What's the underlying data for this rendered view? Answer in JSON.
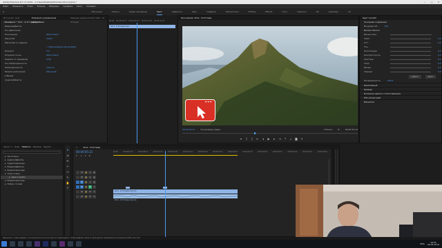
{
  "window": {
    "title": "Adobe Premiere Pro CC 2019 - C:\\Users\\Desktop\\Premiere Pro\\1.prproj *",
    "controls": [
      "—",
      "□",
      "✕"
    ]
  },
  "menu": [
    "Файл",
    "Изменить",
    "Клип",
    "Эпизод",
    "Маркеры",
    "Графика",
    "Окно",
    "Справка"
  ],
  "workspaces": {
    "items": [
      "Обучение",
      "Сборка",
      "Редактирование",
      "Цвет",
      "Эффекты",
      "Звук",
      "Графика",
      "Библиотеки",
      "Editing",
      "Effects",
      "Color",
      "Captions",
      "VR",
      "Assembly",
      "All"
    ],
    "active_index": 3
  },
  "left_panel": {
    "tabs": [
      "Источник: (нет клипов)",
      "Элементы управления эффектами",
      "Микшер аудиоклипов: Шоп - И Отправ"
    ],
    "header": "Основной * Shot - И Отправ.mp4",
    "section_video": "Видеоэффекты",
    "rows": [
      {
        "label": "fx ▸ Движение",
        "value": ""
      },
      {
        "label": "Положение",
        "value": "960,0   540,0"
      },
      {
        "label": "Масштаб",
        "value": "100,0"
      },
      {
        "label": "Масштаб по ширине",
        "value": ""
      },
      {
        "label": "",
        "value": "✓ Равномерное масштабир."
      },
      {
        "label": "Поворот",
        "value": "0,0"
      },
      {
        "label": "Опорная точка",
        "value": "960,0   540,0"
      },
      {
        "label": "Защита от мерцания",
        "value": "0,00"
      },
      {
        "label": "fx ▸ Непрозрачность",
        "value": ""
      },
      {
        "label": "Непрозрачность",
        "value": "100,0 %"
      },
      {
        "label": "Режим наложения",
        "value": "Обычный"
      },
      {
        "label": "▸ Время",
        "value": ""
      },
      {
        "label": "Аудиоэффекты",
        "value": ""
      }
    ],
    "mini_timeline": {
      "clip": "Shot - И Отправ.mp4",
      "ticks": [
        "00:00",
        "00:00:04:23",
        "00:00:09:23",
        "00:00:14:23",
        "00:00:19:23"
      ]
    }
  },
  "program_monitor": {
    "tab": "Программа: Shot - И Отправ",
    "timecode": "00:00:05:21",
    "fit": "По размеру кадра",
    "quality": "Полное",
    "duration": "00:00:23:12",
    "subscribe_button_dots": "•••"
  },
  "lumetri": {
    "tab": "Цвет Lumetri",
    "section": "Основная коррекция",
    "lut_label": "Входная LUT",
    "lut_value": "Нет",
    "wb_header": "Баланс белого",
    "rows": [
      {
        "label": "Баланс бел.",
        "value": ""
      },
      {
        "label": "Темп.",
        "value": "0,0"
      },
      {
        "label": "Отт.",
        "value": "0,0"
      },
      {
        "label": "Тон",
        "value": ""
      },
      {
        "label": "Экспозиция",
        "value": "0,0"
      },
      {
        "label": "Контрастность",
        "value": "0,0"
      },
      {
        "label": "Светлые",
        "value": "0,0"
      },
      {
        "label": "Тени",
        "value": "0,0"
      },
      {
        "label": "Белые",
        "value": "0,0"
      },
      {
        "label": "Черные",
        "value": "0,0"
      }
    ],
    "reset_button": "Сброс",
    "auto_button": "Авто",
    "saturation_label": "Насыщенность",
    "saturation_value": "100,0",
    "sections": [
      "Креативный",
      "Кривые",
      "Колесики цвета и сопоставление",
      "HSL-вторичный",
      "Виньетка"
    ]
  },
  "project_panel": {
    "tabs": [
      "Проект: 1",
      "Инфо",
      "Эффекты",
      "Маркеры",
      "Журнал"
    ],
    "items": [
      "Заготовки",
      "Аудиоэффекты",
      "Аудиопереходы",
      "Видеоэффекты",
      "Видеопереходы",
      "Подготовка",
      "Цвет Lumetri",
      "Видеопереходы",
      "Набор стилей"
    ]
  },
  "timeline": {
    "tab": "Shot - И Отправ",
    "timecode": "00:00:05:21",
    "ruler": [
      "00:00",
      "00:00:04:23",
      "00:00:09:23",
      "00:00:14:23",
      "00:00:19:23",
      "00:00:24:23",
      "00:00:29:23",
      "00:00:34:23",
      "00:00:39:23",
      "00:00:44:23",
      "00:00:49:23",
      "00:00:54:23",
      "00:00:59:23",
      "00:01:04:23",
      "00:01:09:23"
    ],
    "video_tracks": [
      "V3",
      "V2",
      "V1"
    ],
    "audio_tracks": [
      "A1",
      "A2",
      "A3"
    ],
    "clip_name": "Shot - И Отправ.mp4 [V]",
    "audio_clip_name": "Shot - И Отправ.mp4 [A]"
  },
  "status_bar": "Щелкните, чтобы выбрать, или щелкните в пустом месте и перетащите, чтобы выбрать область. Для других параметров используйте Shift, Alt и Ctrl.",
  "taskbar": {
    "time": "18:55",
    "date": "06.05.2019",
    "lang": "ENG"
  },
  "colors": {
    "accent_blue": "#4e9bf0",
    "clip_blue": "#8fb4e6",
    "clip_audio": "#9dc0e8",
    "playhead": "#4e9bf0",
    "subscribe_red": "#d93025"
  }
}
